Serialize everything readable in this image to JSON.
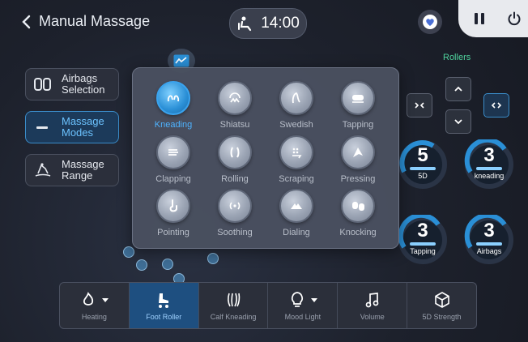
{
  "header": {
    "title": "Manual Massage",
    "time": "14:00"
  },
  "sidebar": {
    "items": [
      {
        "label_line1": "Airbags",
        "label_line2": "Selection",
        "icon": "airbag-icon",
        "active": false
      },
      {
        "label_line1": "Massage",
        "label_line2": "Modes",
        "icon": "minus-icon",
        "active": true
      },
      {
        "label_line1": "Massage",
        "label_line2": "Range",
        "icon": "body-range-icon",
        "active": false
      }
    ]
  },
  "modes": [
    {
      "label": "Kneading",
      "icon": "kneading-icon",
      "active": true
    },
    {
      "label": "Shiatsu",
      "icon": "shiatsu-icon",
      "active": false
    },
    {
      "label": "Swedish",
      "icon": "swedish-icon",
      "active": false
    },
    {
      "label": "Tapping",
      "icon": "tapping-icon",
      "active": false
    },
    {
      "label": "Clapping",
      "icon": "clapping-icon",
      "active": false
    },
    {
      "label": "Rolling",
      "icon": "rolling-icon",
      "active": false
    },
    {
      "label": "Scraping",
      "icon": "scraping-icon",
      "active": false
    },
    {
      "label": "Pressing",
      "icon": "pressing-icon",
      "active": false
    },
    {
      "label": "Pointing",
      "icon": "pointing-icon",
      "active": false
    },
    {
      "label": "Soothing",
      "icon": "soothing-icon",
      "active": false
    },
    {
      "label": "Dialing",
      "icon": "dialing-icon",
      "active": false
    },
    {
      "label": "Knocking",
      "icon": "knocking-icon",
      "active": false
    }
  ],
  "rollers": {
    "label": "Rollers"
  },
  "gauges": [
    {
      "value": "5",
      "label": "5D",
      "level": 0.55
    },
    {
      "value": "3",
      "label": "kneading",
      "level": 0.6
    },
    {
      "value": "3",
      "label": "Tapping",
      "level": 0.6
    },
    {
      "value": "3",
      "label": "Airbags",
      "level": 0.6
    }
  ],
  "bottom_bar": {
    "items": [
      {
        "label": "Heating",
        "icon": "flame-icon",
        "dropdown": true,
        "active": false
      },
      {
        "label": "Foot Roller",
        "icon": "foot-roller-icon",
        "dropdown": false,
        "active": true
      },
      {
        "label": "Calf Kneading",
        "icon": "calf-kneading-icon",
        "dropdown": false,
        "active": false
      },
      {
        "label": "Mood Light",
        "icon": "bulb-icon",
        "dropdown": true,
        "active": false
      },
      {
        "label": "Volume",
        "icon": "music-note-icon",
        "dropdown": false,
        "active": false
      },
      {
        "label": "5D Strength",
        "icon": "cube-icon",
        "dropdown": false,
        "active": false
      }
    ]
  },
  "colors": {
    "accent": "#3aa3ee",
    "active_bg": "#1e4f80",
    "rollers_green": "#4fd39d"
  }
}
